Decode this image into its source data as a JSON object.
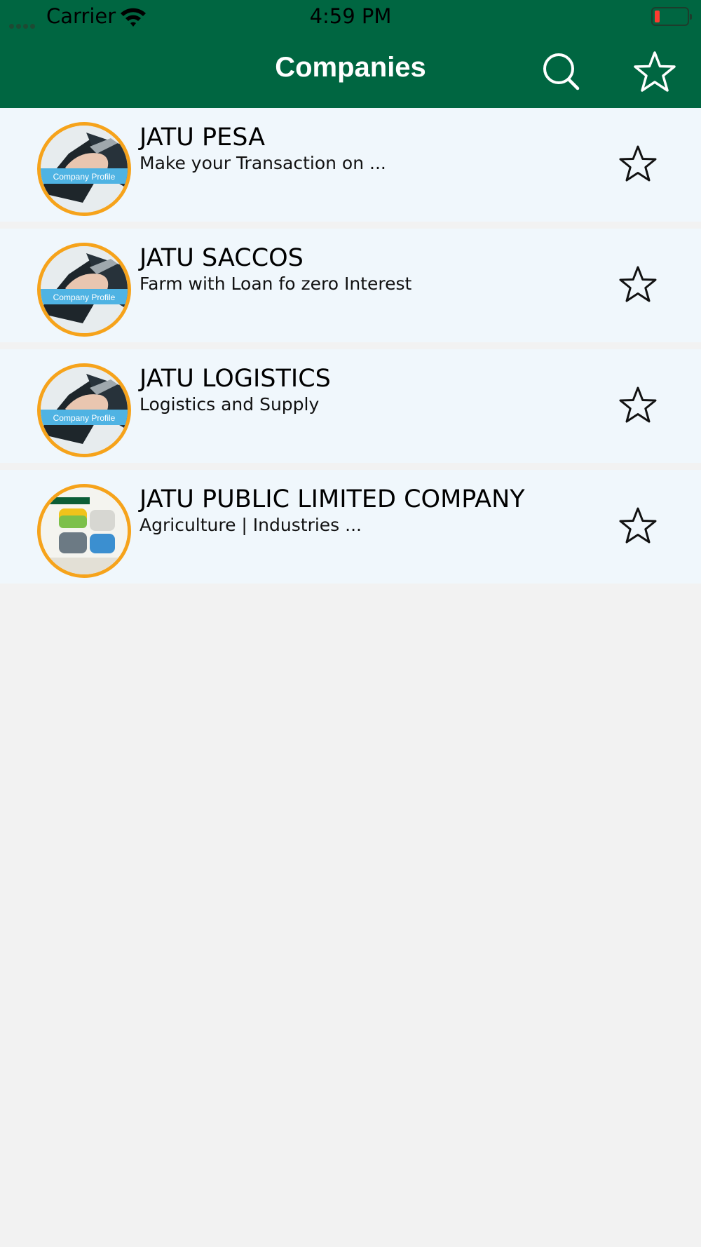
{
  "status_bar": {
    "carrier": "Carrier",
    "time": "4:59 PM",
    "battery_color": "#ff3b30"
  },
  "nav": {
    "title": "Companies",
    "search_icon": "search-icon",
    "favorites_icon": "star-outline-icon",
    "background": "#006641"
  },
  "companies": [
    {
      "name": "JATU PESA",
      "description": "Make your Transaction on ...",
      "avatar_label": "Company Profile",
      "avatar_kind": "handshake-image",
      "favorite": false
    },
    {
      "name": "JATU SACCOS",
      "description": "Farm with Loan fo zero Interest",
      "avatar_label": "Company Profile",
      "avatar_kind": "handshake-image",
      "favorite": false
    },
    {
      "name": "JATU LOGISTICS",
      "description": "Logistics and Supply",
      "avatar_label": "Company Profile",
      "avatar_kind": "handshake-image",
      "favorite": false
    },
    {
      "name": "JATU PUBLIC LIMITED COMPANY",
      "description": "Agriculture | Industries ...",
      "avatar_label": "",
      "avatar_kind": "poster-image",
      "favorite": false
    }
  ],
  "colors": {
    "accent": "#006641",
    "avatar_ring": "#f6a31b",
    "row_background": "#f0f7fc",
    "page_background": "#f2f2f2",
    "label_banner": "#4fb3e3"
  }
}
